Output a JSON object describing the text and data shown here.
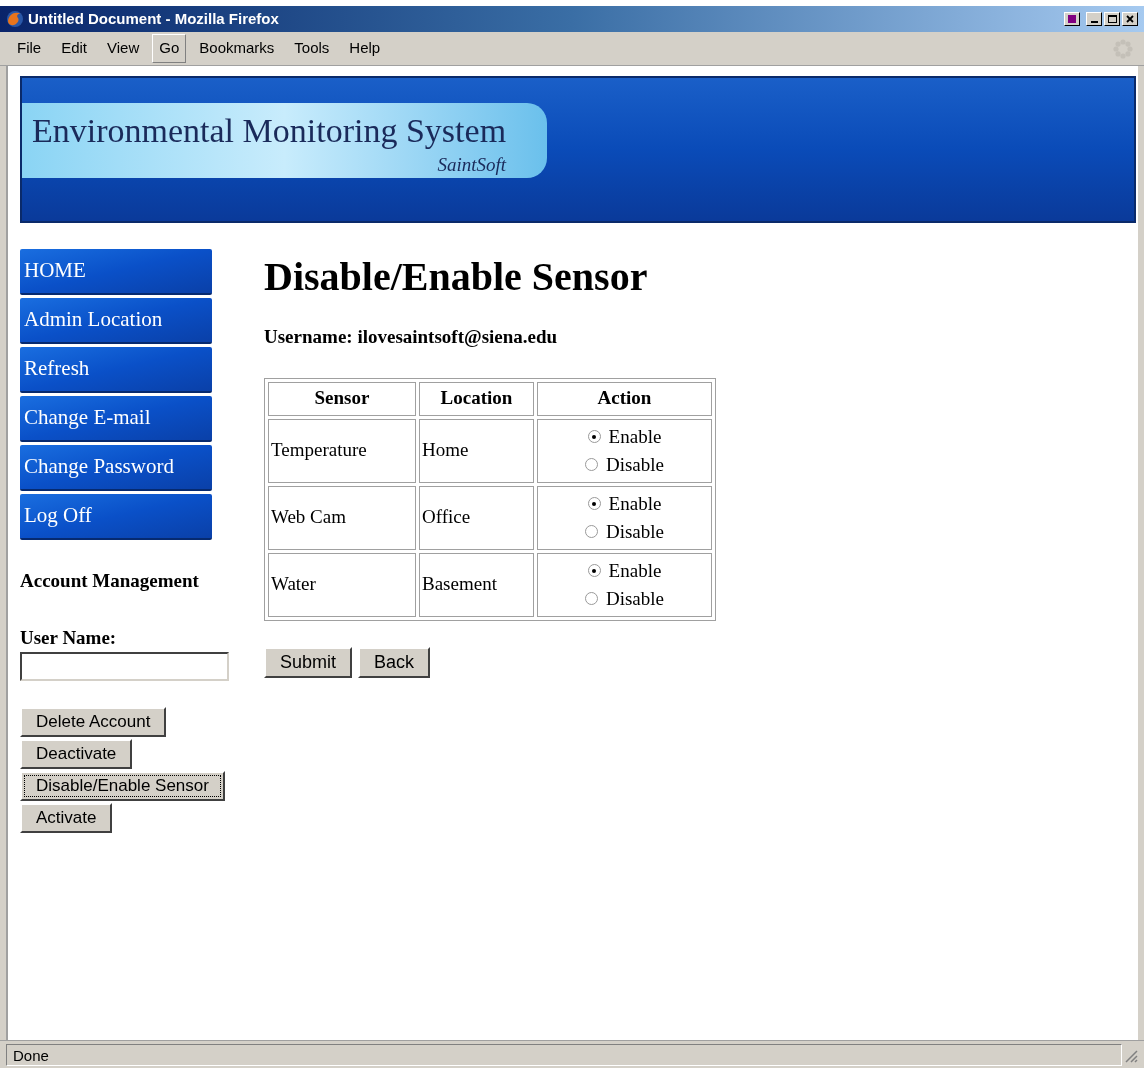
{
  "window": {
    "title": "Untitled Document - Mozilla Firefox"
  },
  "menu": [
    {
      "label": "File",
      "highlighted": false
    },
    {
      "label": "Edit",
      "highlighted": false
    },
    {
      "label": "View",
      "highlighted": false
    },
    {
      "label": "Go",
      "highlighted": true
    },
    {
      "label": "Bookmarks",
      "highlighted": false
    },
    {
      "label": "Tools",
      "highlighted": false
    },
    {
      "label": "Help",
      "highlighted": false
    }
  ],
  "banner": {
    "title": "Environmental Monitoring System",
    "subtitle": "SaintSoft"
  },
  "nav": [
    "HOME",
    "Admin Location",
    "Refresh",
    "Change E-mail",
    "Change Password",
    "Log Off"
  ],
  "account": {
    "heading": "Account Management",
    "field_label": "User Name:",
    "buttons": [
      {
        "label": "Delete Account",
        "focused": false
      },
      {
        "label": "Deactivate",
        "focused": false
      },
      {
        "label": "Disable/Enable Sensor",
        "focused": true
      },
      {
        "label": "Activate",
        "focused": false
      }
    ]
  },
  "page": {
    "heading": "Disable/Enable Sensor",
    "username": "Username: ilovesaintsoft@siena.edu"
  },
  "table": {
    "columns": [
      "Sensor",
      "Location",
      "Action"
    ],
    "rows": [
      {
        "sensor": "Temperature",
        "location": "Home",
        "options": [
          {
            "label": "Enable",
            "selected": true
          },
          {
            "label": "Disable",
            "selected": false
          }
        ]
      },
      {
        "sensor": "Web Cam",
        "location": "Office",
        "options": [
          {
            "label": "Enable",
            "selected": true
          },
          {
            "label": "Disable",
            "selected": false
          }
        ]
      },
      {
        "sensor": "Water",
        "location": "Basement",
        "options": [
          {
            "label": "Enable",
            "selected": true
          },
          {
            "label": "Disable",
            "selected": false
          }
        ]
      }
    ]
  },
  "form_buttons": [
    "Submit",
    "Back"
  ],
  "status_bar": {
    "text": "Done"
  }
}
